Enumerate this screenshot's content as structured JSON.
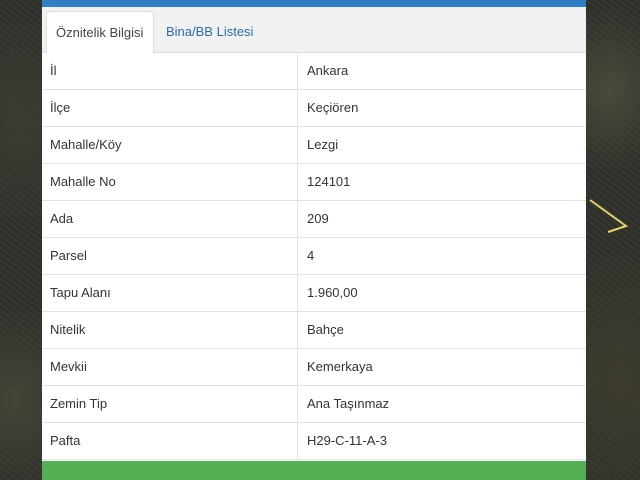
{
  "tabs": [
    {
      "label": "Öznitelik Bilgisi"
    },
    {
      "label": "Bina/BB Listesi"
    }
  ],
  "rows": [
    {
      "label": "İl",
      "value": "Ankara"
    },
    {
      "label": "İlçe",
      "value": "Keçiören"
    },
    {
      "label": "Mahalle/Köy",
      "value": "Lezgi"
    },
    {
      "label": "Mahalle No",
      "value": "124101"
    },
    {
      "label": "Ada",
      "value": "209"
    },
    {
      "label": "Parsel",
      "value": "4"
    },
    {
      "label": "Tapu Alanı",
      "value": "1.960,00"
    },
    {
      "label": "Nitelik",
      "value": "Bahçe"
    },
    {
      "label": "Mevkii",
      "value": "Kemerkaya"
    },
    {
      "label": "Zemin Tip",
      "value": "Ana Taşınmaz"
    },
    {
      "label": "Pafta",
      "value": "H29-C-11-A-3"
    }
  ],
  "colors": {
    "header_accent": "#2f7fc6",
    "footer_accent": "#55b055",
    "tab_link": "#2a6cae"
  },
  "icons": {
    "map_marker": "parcel-outline-icon"
  }
}
